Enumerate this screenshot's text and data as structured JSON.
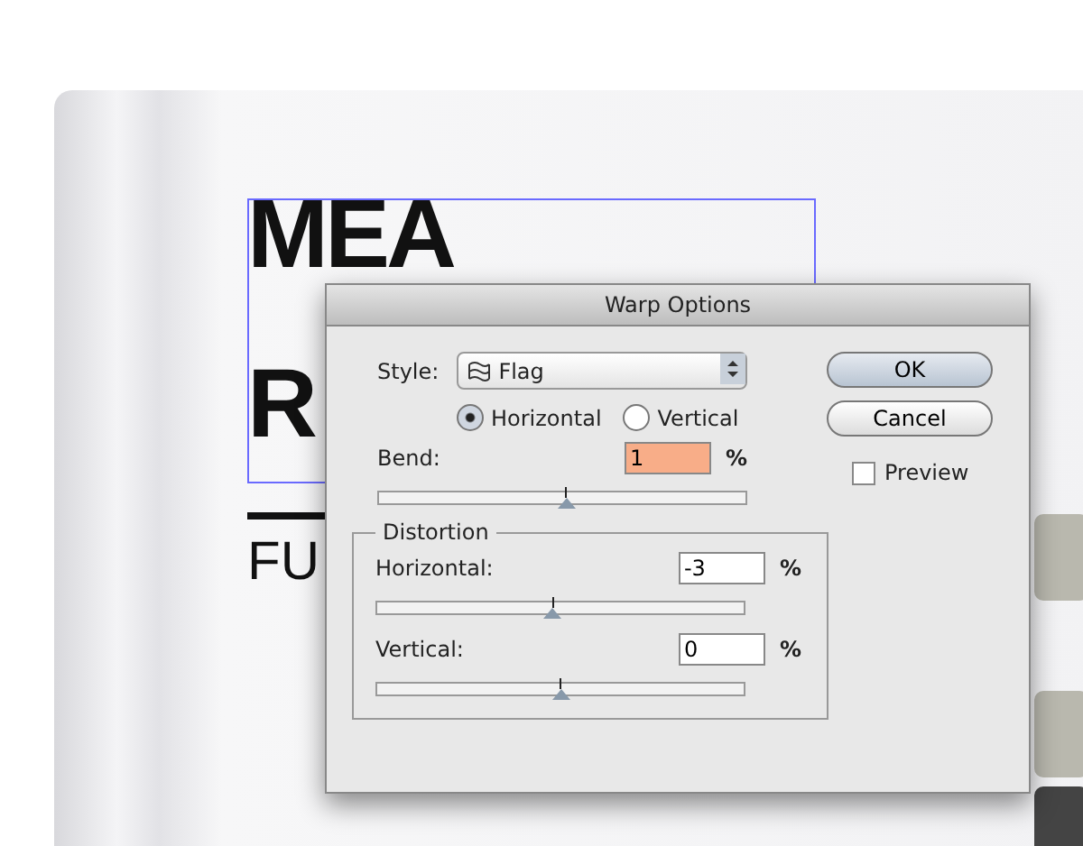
{
  "artwork": {
    "headline_line_1": "MEA",
    "headline_line_2": "R",
    "subline": "FU"
  },
  "dialog": {
    "title": "Warp Options",
    "style": {
      "label": "Style:",
      "value": "Flag"
    },
    "orientation": [
      {
        "label": "Horizontal",
        "selected": true
      },
      {
        "label": "Vertical",
        "selected": false
      }
    ],
    "bend": {
      "label": "Bend:",
      "value": "1",
      "unit": "%",
      "level": 0.51,
      "highlighted": true
    },
    "distortion": {
      "title": "Distortion",
      "fields": [
        {
          "label": "Horizontal:",
          "value": "-3",
          "unit": "%",
          "level": 0.48,
          "highlighted": false
        },
        {
          "label": "Vertical:",
          "value": "0",
          "unit": "%",
          "level": 0.5,
          "highlighted": false
        }
      ]
    },
    "buttons": [
      {
        "label": "OK",
        "default": true
      },
      {
        "label": "Cancel",
        "default": false
      }
    ],
    "preview": {
      "label": "Preview",
      "checked": false
    }
  }
}
